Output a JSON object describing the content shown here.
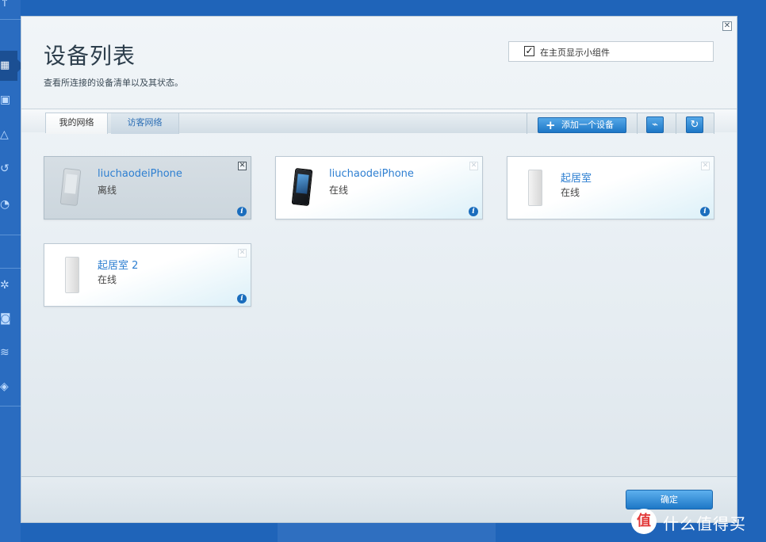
{
  "dialog": {
    "title": "设备列表",
    "subtitle": "查看所连接的设备清单以及其状态。",
    "close_icon": "close-icon",
    "widget_checkbox": {
      "label": "在主页显示小组件",
      "checked": true
    }
  },
  "tabs": [
    {
      "label": "我的网络",
      "active": true
    },
    {
      "label": "访客网络",
      "active": false
    }
  ],
  "toolbar": {
    "add_device_label": "添加一个设备",
    "clean_icon": "broom-icon",
    "refresh_icon": "refresh-icon"
  },
  "devices": [
    {
      "name": "liuchaodeiPhone",
      "status": "离线",
      "type": "phone",
      "online": false
    },
    {
      "name": "liuchaodeiPhone",
      "status": "在线",
      "type": "phone",
      "online": true
    },
    {
      "name": "起居室",
      "status": "在线",
      "type": "router",
      "online": true
    },
    {
      "name": "起居室 2",
      "status": "在线",
      "type": "router",
      "online": true
    }
  ],
  "footer": {
    "ok_label": "确定"
  },
  "sidebar": {
    "icons": [
      "network-icon",
      "calendar-icon",
      "warning-icon",
      "restore-icon",
      "speed-icon",
      "settings-icon",
      "camera-icon",
      "wifi-icon",
      "shield-icon"
    ]
  },
  "watermark": {
    "text": "什么值得买",
    "logo": "值"
  },
  "colors": {
    "accent": "#1d77c6",
    "link": "#2e7fd1",
    "background": "#1f64b9"
  }
}
